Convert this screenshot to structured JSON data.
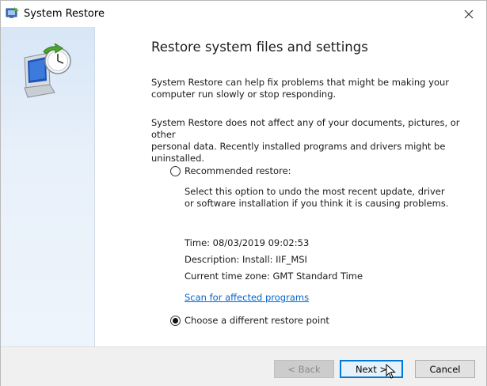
{
  "window": {
    "title": "System Restore",
    "close_label": "Close"
  },
  "main": {
    "heading": "Restore system files and settings",
    "para1": "System Restore can help fix problems that might be making your\ncomputer run slowly or stop responding.",
    "para2": "System Restore does not affect any of your documents, pictures, or other\npersonal data. Recently installed programs and drivers might be\nuninstalled.",
    "recommended": {
      "label": "Recommended restore:",
      "description": "Select this option to undo the most recent update, driver\nor software installation if you think it is causing problems.",
      "time": "Time: 08/03/2019 09:02:53",
      "desc": "Description: Install: IIF_MSI",
      "timezone": "Current time zone: GMT Standard Time",
      "scan_link": "Scan for affected programs",
      "selected": false
    },
    "different": {
      "label": "Choose a different restore point",
      "selected": true
    }
  },
  "buttons": {
    "back": "< Back",
    "next": "Next >",
    "cancel": "Cancel"
  },
  "colors": {
    "accent": "#0078d7",
    "link": "#0066cc"
  },
  "icons": {
    "app": "system-restore-icon",
    "hero": "monitor-clock-icon",
    "close": "close-icon"
  }
}
